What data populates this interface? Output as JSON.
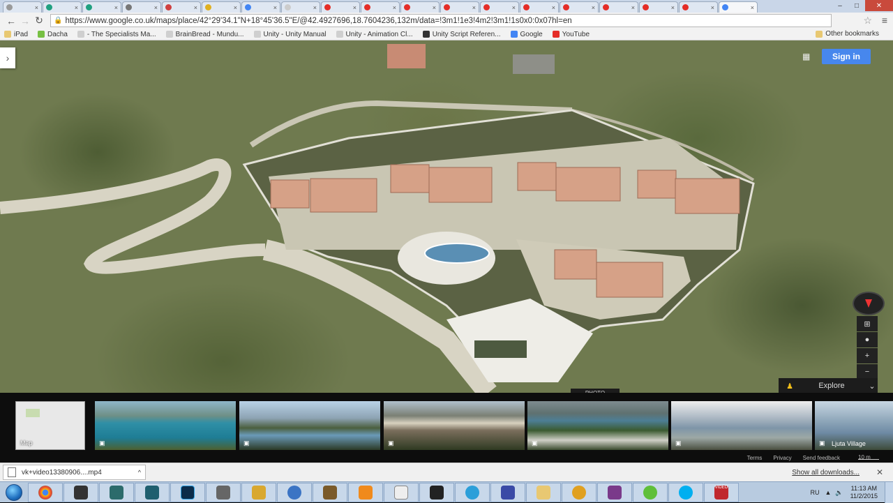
{
  "browser": {
    "url": "https://www.google.co.uk/maps/place/42°29'34.1\"N+18°45'36.5\"E/@42.4927696,18.7604236,132m/data=!3m1!1e3!4m2!3m1!1s0x0:0x07hl=en",
    "tabs_count": 18
  },
  "bookmarks": [
    {
      "label": "iPad",
      "icon": "folder-icon",
      "color": "#e8c872"
    },
    {
      "label": "Dacha",
      "icon": "folder-icon",
      "color": "#77c043"
    },
    {
      "label": "- The Specialists Ma...",
      "icon": "page-icon",
      "color": "#cfcfcf"
    },
    {
      "label": "BrainBread - Mundu...",
      "icon": "page-icon",
      "color": "#cfcfcf"
    },
    {
      "label": "Unity - Unity Manual",
      "icon": "page-icon",
      "color": "#cfcfcf"
    },
    {
      "label": "Unity - Animation Cl...",
      "icon": "page-icon",
      "color": "#cfcfcf"
    },
    {
      "label": "Unity Script Referen...",
      "icon": "unity-icon",
      "color": "#333333"
    },
    {
      "label": "Google",
      "icon": "google-icon",
      "color": "#4285f4"
    },
    {
      "label": "YouTube",
      "icon": "youtube-icon",
      "color": "#e52d27"
    }
  ],
  "other_bookmarks": "Other bookmarks",
  "map": {
    "signin_label": "Sign in",
    "explore_label": "Explore",
    "photo_tab": "PHOTO",
    "minimap_label": "Map",
    "thumbnails": [
      {
        "label": ""
      },
      {
        "label": ""
      },
      {
        "label": ""
      },
      {
        "label": ""
      },
      {
        "label": ""
      },
      {
        "label": "Ljuta Village"
      }
    ],
    "footer_links": [
      "Terms",
      "Privacy",
      "Send feedback"
    ],
    "scale": "10 m"
  },
  "downloads": {
    "file": "vk+video13380906....mp4",
    "show_all": "Show all downloads..."
  },
  "taskbar": {
    "lang": "RU",
    "time": "11:13 AM",
    "date": "11/2/2015",
    "video_badge": "VIDEO"
  }
}
